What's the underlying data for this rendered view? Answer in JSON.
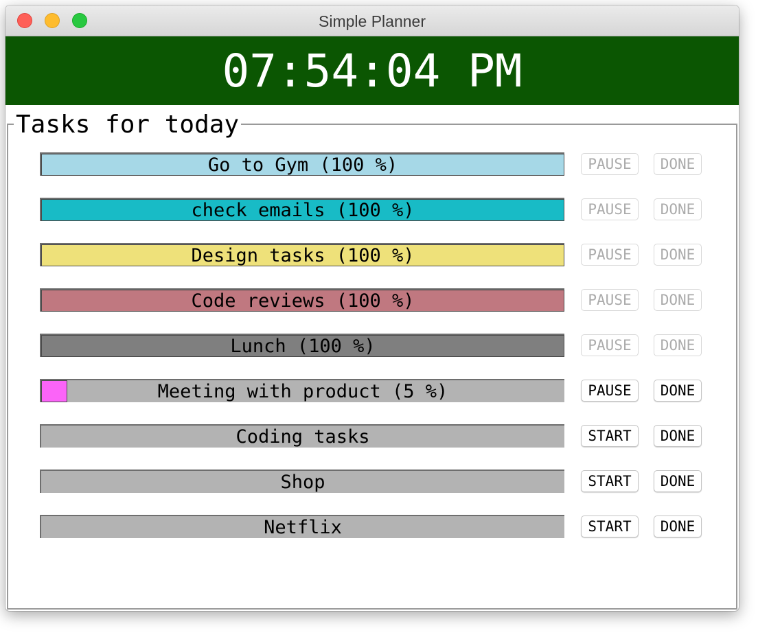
{
  "window": {
    "title": "Simple Planner"
  },
  "clock": {
    "time": "07:54:04 PM",
    "background": "#0b5602"
  },
  "tasks_frame": {
    "label": "Tasks for today"
  },
  "tasks": [
    {
      "label": "Go to Gym (100 %)",
      "progress": 1.0,
      "color": "#a6d8e7",
      "action": "PAUSE",
      "action_enabled": false,
      "done": "DONE",
      "done_enabled": false
    },
    {
      "label": "check emails (100 %)",
      "progress": 1.0,
      "color": "#18bbc6",
      "action": "PAUSE",
      "action_enabled": false,
      "done": "DONE",
      "done_enabled": false
    },
    {
      "label": "Design tasks (100 %)",
      "progress": 1.0,
      "color": "#eee17a",
      "action": "PAUSE",
      "action_enabled": false,
      "done": "DONE",
      "done_enabled": false
    },
    {
      "label": "Code reviews (100 %)",
      "progress": 1.0,
      "color": "#c07880",
      "action": "PAUSE",
      "action_enabled": false,
      "done": "DONE",
      "done_enabled": false
    },
    {
      "label": "Lunch (100 %)",
      "progress": 1.0,
      "color": "#7f7f7f",
      "action": "PAUSE",
      "action_enabled": false,
      "done": "DONE",
      "done_enabled": false
    },
    {
      "label": "Meeting with product (5 %)",
      "progress": 0.05,
      "color": "#fb64f8",
      "action": "PAUSE",
      "action_enabled": true,
      "done": "DONE",
      "done_enabled": true
    },
    {
      "label": "Coding tasks",
      "progress": 0,
      "color": "#b3b3b3",
      "action": "START",
      "action_enabled": true,
      "done": "DONE",
      "done_enabled": true
    },
    {
      "label": "Shop",
      "progress": 0,
      "color": "#b3b3b3",
      "action": "START",
      "action_enabled": true,
      "done": "DONE",
      "done_enabled": true
    },
    {
      "label": "Netflix",
      "progress": 0,
      "color": "#b3b3b3",
      "action": "START",
      "action_enabled": true,
      "done": "DONE",
      "done_enabled": true
    }
  ]
}
